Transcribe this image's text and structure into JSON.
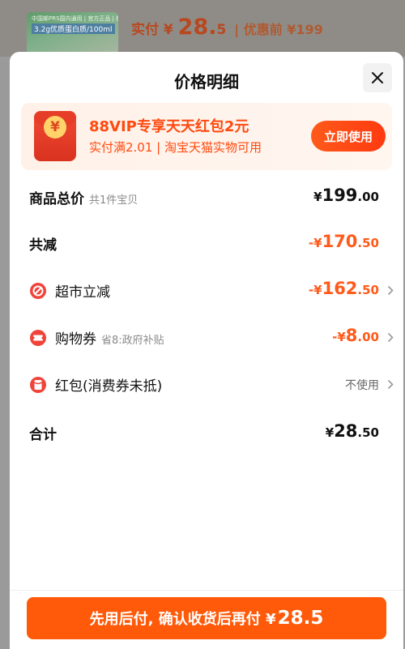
{
  "background": {
    "thumb_line1": "中国邮PRS国内通用 | 官方正品 | 极速发货",
    "thumb_line2": "3.2g优质蛋白质/100ml",
    "price_prefix": "实付 ¥ ",
    "price_int": "28.",
    "price_dec": "5",
    "orig_price": "| 优惠前 ¥199"
  },
  "sheet": {
    "title": "价格明细",
    "close_icon": "close-icon"
  },
  "promo": {
    "coin_symbol": "¥",
    "title": "88VIP专享天天红包2元",
    "subtitle": "实付满2.01 | 淘宝天猫实物可用",
    "button": "立即使用"
  },
  "rows": {
    "goods_total": {
      "label": "商品总价",
      "hint": "共1件宝贝",
      "currency": "¥",
      "int": "199",
      "dec": ".00"
    },
    "total_discount": {
      "label": "共减",
      "prefix": "-¥",
      "int": "170",
      "dec": ".50"
    },
    "supermarket": {
      "label": "超市立减",
      "prefix": "-¥",
      "int": "162",
      "dec": ".50",
      "icon": "discount-icon"
    },
    "coupon": {
      "label": "购物券",
      "hint": "省8:政府补贴",
      "prefix": "-¥",
      "int": "8",
      "dec": ".00",
      "icon": "ticket-icon"
    },
    "red_packet": {
      "label": "红包(消费券未抵)",
      "value": "不使用",
      "icon": "red-packet-icon"
    },
    "total": {
      "label": "合计",
      "currency": "¥",
      "int": "28",
      "dec": ".50"
    }
  },
  "footer": {
    "button_text": "先用后付, 确认收货后再付 ¥",
    "button_amount": "28.5"
  },
  "colors": {
    "accent": "#ff5a1a",
    "promo_bg": "#fff3ec",
    "overlay": "#9a9a9a"
  }
}
